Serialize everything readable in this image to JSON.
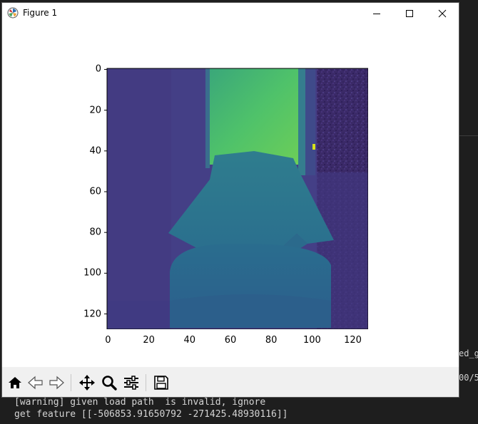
{
  "window": {
    "title": "Figure 1"
  },
  "toolbar": {
    "buttons": [
      {
        "icon": "home-icon",
        "label": "Home"
      },
      {
        "icon": "back-arrow-icon",
        "label": "Back"
      },
      {
        "icon": "forward-arrow-icon",
        "label": "Forward"
      },
      {
        "icon": "pan-icon",
        "label": "Pan"
      },
      {
        "icon": "zoom-icon",
        "label": "Zoom"
      },
      {
        "icon": "configure-subplots-icon",
        "label": "Subplots"
      },
      {
        "icon": "save-icon",
        "label": "Save"
      }
    ]
  },
  "plot": {
    "x_ticks": [
      "0",
      "20",
      "40",
      "60",
      "80",
      "100",
      "120"
    ],
    "y_ticks": [
      "0",
      "20",
      "40",
      "60",
      "80",
      "100",
      "120"
    ],
    "colormap": "viridis"
  },
  "console": {
    "line1": "[warning] given load path  is invalid, ignore",
    "line2": "get feature [[-506853.91650792 -271425.48930116]]"
  },
  "background_fragments": {
    "frag1": "ed_g",
    "frag2": "00/5"
  },
  "colors": {
    "background_purple": "#433e85",
    "door_green": "#48c16e",
    "object_teal": "#2f7f8e",
    "dark_purple": "#3b2c6b"
  }
}
